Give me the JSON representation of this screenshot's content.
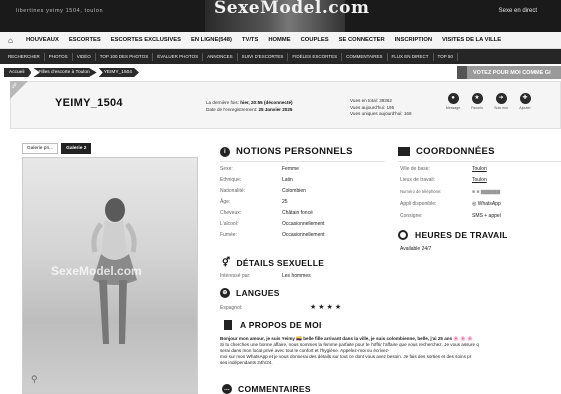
{
  "banner": {
    "tagline": "libertines yeimy 1504, toulon",
    "logo": "SexeModel.com",
    "right_link": "Sexe en direct"
  },
  "nav": {
    "items": [
      "HOUVEAUX",
      "ESCORTES",
      "ESCORTES EXCLUSIVES",
      "EN LIGNE(548)",
      "TV/TS",
      "HOMME",
      "COUPLES",
      "SE CONNECTER",
      "INSCRIPTION",
      "VISITES DE LA VILLE"
    ]
  },
  "subnav": {
    "items": [
      "RECHERCHER",
      "PHOTOS",
      "VIDÉO",
      "TOP 100 DES PHOTOS",
      "ÉVALUER PHOTOS",
      "ANNONCES",
      "SUIVI D'ESCORTES",
      "FIDÈLES ESCORTES",
      "COMMENTAIRES",
      "FLUX EN DIRECT",
      "TOP 50"
    ]
  },
  "breadcrumb": [
    "Accueil",
    "Filles d'escorte à Toulon",
    "YEIMY_1504"
  ],
  "vote": "VOTEZ POUR MOI COMME GI",
  "profile": {
    "vip": "VIP",
    "username": "YEIMY_1504",
    "last_seen_label": "La dernière fois:",
    "last_seen": "hier, 20:55 (déconnecté)",
    "registered_label": "Date de l'enregistrement:",
    "registered": "25 Janvier 2025",
    "views_total": "Vues en total: 39362",
    "views_yesterday": "Vues aujourd'hui: 195",
    "views_unique": "Vues uniques aujourd'hui: 166",
    "actions": [
      {
        "label": "Message",
        "icon": "message-icon",
        "glyph": "●"
      },
      {
        "label": "Favoris",
        "icon": "favorite-icon",
        "glyph": "★"
      },
      {
        "label": "Suis moi",
        "icon": "follow-icon",
        "glyph": "➜"
      },
      {
        "label": "Ajouter",
        "icon": "add-icon",
        "glyph": "✚"
      }
    ]
  },
  "gallery": {
    "tabs": [
      "Galerie pri...",
      "Galerie 2"
    ],
    "watermark": "SexeModel.com"
  },
  "notions": {
    "title": "NOTIONS PERSONNELS",
    "rows": [
      {
        "label": "Sexe:",
        "value": "Femme"
      },
      {
        "label": "Ethnique:",
        "value": "Latin"
      },
      {
        "label": "Nationalité:",
        "value": "Colombien"
      },
      {
        "label": "Âge:",
        "value": "25"
      },
      {
        "label": "Cheveux:",
        "value": "Châtain foncé"
      },
      {
        "label": "L'alcool:",
        "value": "Occasionnellement"
      },
      {
        "label": "Fumée:",
        "value": "Occasionnellement"
      }
    ]
  },
  "details": {
    "title": "DÉTAILS SEXUELLE",
    "label": "Intéressé par:",
    "value": "Les hommes"
  },
  "langues": {
    "title": "LANGUES",
    "label": "Espagnol:",
    "stars": "★★★★"
  },
  "coordonnees": {
    "title": "COORDONNÉES",
    "rows": [
      {
        "label": "Ville de base:",
        "value": "Toulon"
      },
      {
        "label": "Lieux de travail:",
        "value": "Toulon"
      },
      {
        "label": "Numéro de téléphone:",
        "value": "■ ■ ▆▆▆▆▆"
      },
      {
        "label": "Appli disponible:",
        "value": "WhatsApp"
      },
      {
        "label": "Consigne:",
        "value": "SMS + appel"
      }
    ]
  },
  "heures": {
    "title": "HEURES DE TRAVAIL",
    "value": "Available 24/7"
  },
  "apropos": {
    "title": "A PROPOS DE MOI",
    "lead": "Bonjour mon amour, je suis Yeimy 🇨🇴 belle fille arrivant dans la ville, je suis colombienne, belle, j'ai 25 ans 🌸 🌸 🌸",
    "lines": [
      "Si tu cherches une bonne affaire, nous sommes la femme parfaite pour te l'offrir l'affaire que vous recherchez. Je vous assure q",
      "serai dans mon local privé avec tout le confort et l'hygiène. Appelez-moi ou écrivez-",
      "moi sur mon WhatsApp et je vous donnerai des détails sur tout ce dont vous avez besoin. Je fais des sorties et des soins pr",
      "ses indépendants 24h/24."
    ]
  },
  "comments": {
    "title": "COMMENTAIRES"
  }
}
